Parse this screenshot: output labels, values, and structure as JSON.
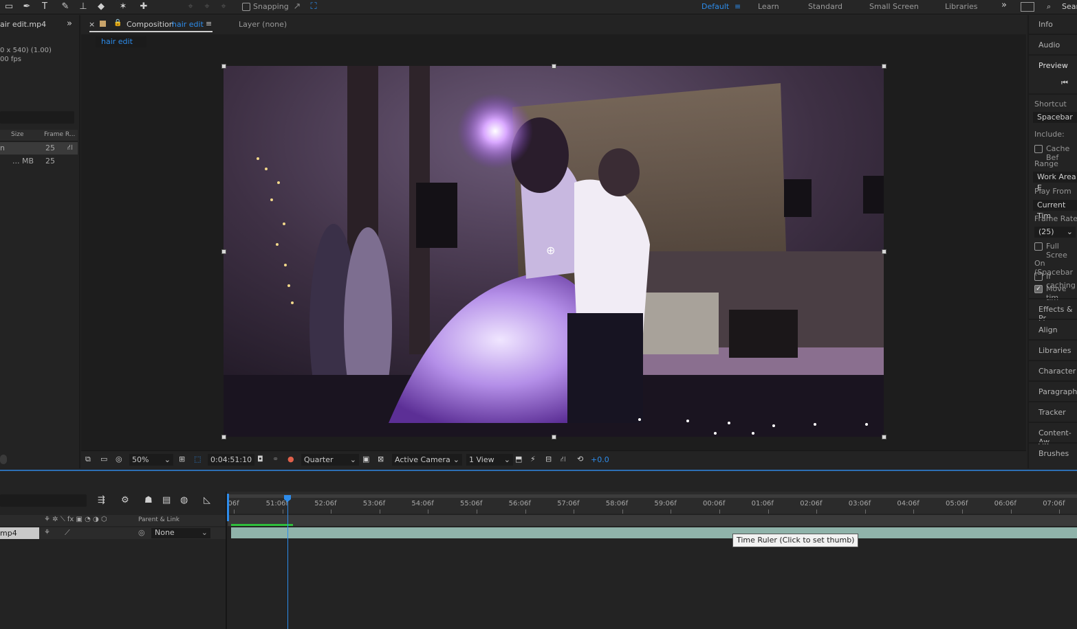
{
  "toolbar": {
    "snapping_label": "Snapping",
    "workspaces": [
      "Default",
      "Learn",
      "Standard",
      "Small Screen",
      "Libraries"
    ],
    "active_workspace": "Default",
    "search_label": "Sear"
  },
  "project": {
    "footage_name": "air edit.mp4",
    "footage_dims": "0 x 540) (1.00)",
    "footage_fps": "00 fps",
    "columns": [
      "Size",
      "Frame R..."
    ],
    "rows": [
      {
        "name": "n",
        "size": "",
        "fps": "25"
      },
      {
        "name": "",
        "size": "... MB",
        "fps": "25"
      }
    ]
  },
  "comp": {
    "tab_prefix": "Composition",
    "tab_name": "hair edit",
    "layer_tab": "Layer (none)",
    "breadcrumb": "hair edit",
    "zoom": "50%",
    "timecode": "0:04:51:10",
    "resolution": "Quarter",
    "camera": "Active Camera",
    "views": "1 View",
    "exposure": "+0.0"
  },
  "right_panel": {
    "headers": [
      "Info",
      "Audio",
      "Preview"
    ],
    "shortcut_label": "Shortcut",
    "shortcut_value": "Spacebar",
    "include_label": "Include:",
    "cache_label": "Cache Bef",
    "range_label": "Range",
    "range_value": "Work Area E",
    "play_from_label": "Play From",
    "play_from_value": "Current Tim",
    "frame_rate_label": "Frame Rate",
    "frame_rate_value": "(25)",
    "full_screen_label": "Full Scree",
    "on_label": "On (Spacebar",
    "if_caching_label": "If caching",
    "move_time_label": "Move tim",
    "panels": [
      "Effects & Pr",
      "Align",
      "Libraries",
      "Character",
      "Paragraph",
      "Tracker",
      "Content-Aw",
      "Brushes"
    ]
  },
  "timeline": {
    "parent_link_label": "Parent & Link",
    "layer_name": "mp4",
    "parent_value": "None",
    "ruler_labels": [
      ":06f",
      "51:06f",
      "52:06f",
      "53:06f",
      "54:06f",
      "55:06f",
      "56:06f",
      "57:06f",
      "58:06f",
      "59:06f",
      "00:06f",
      "01:06f",
      "02:06f",
      "03:06f",
      "04:06f",
      "05:06f",
      "06:06f",
      "07:06f"
    ],
    "tooltip": "Time Ruler (Click to set thumb)"
  },
  "colors": {
    "accent": "#2d8ceb",
    "panel": "#232323",
    "viewer": "#1d1d1d",
    "layer_bar": "#8fb3aa"
  }
}
